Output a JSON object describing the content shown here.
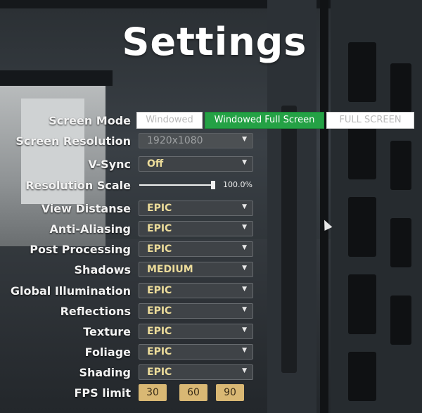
{
  "title": "Settings",
  "screen_mode": {
    "label": "Screen Mode",
    "options": [
      "Windowed",
      "Windowed Full Screen",
      "FULL SCREEN"
    ],
    "selected": "Windowed Full Screen"
  },
  "screen_resolution": {
    "label": "Screen Resolution",
    "value": "1920x1080"
  },
  "vsync": {
    "label": "V-Sync",
    "value": "Off"
  },
  "resolution_scale": {
    "label": "Resolution Scale",
    "value_text": "100.0%",
    "value": 1.0
  },
  "quality": [
    {
      "label": "View Distanse",
      "value": "EPIC"
    },
    {
      "label": "Anti-Aliasing",
      "value": "EPIC"
    },
    {
      "label": "Post Processing",
      "value": "EPIC"
    },
    {
      "label": "Shadows",
      "value": "MEDIUM"
    },
    {
      "label": "Global Illumination",
      "value": "EPIC"
    },
    {
      "label": "Reflections",
      "value": "EPIC"
    },
    {
      "label": "Texture",
      "value": "EPIC"
    },
    {
      "label": "Foliage",
      "value": "EPIC"
    },
    {
      "label": "Shading",
      "value": "EPIC"
    }
  ],
  "fps_limit": {
    "label": "FPS limit",
    "options": [
      "30",
      "60",
      "90"
    ]
  },
  "icons": {
    "dropdown": "caret-down-icon",
    "cursor": "mouse-cursor-icon"
  },
  "colors": {
    "accent_green": "#24a145",
    "value_gold": "#ecdc9a",
    "fps_button": "#d9b874"
  }
}
